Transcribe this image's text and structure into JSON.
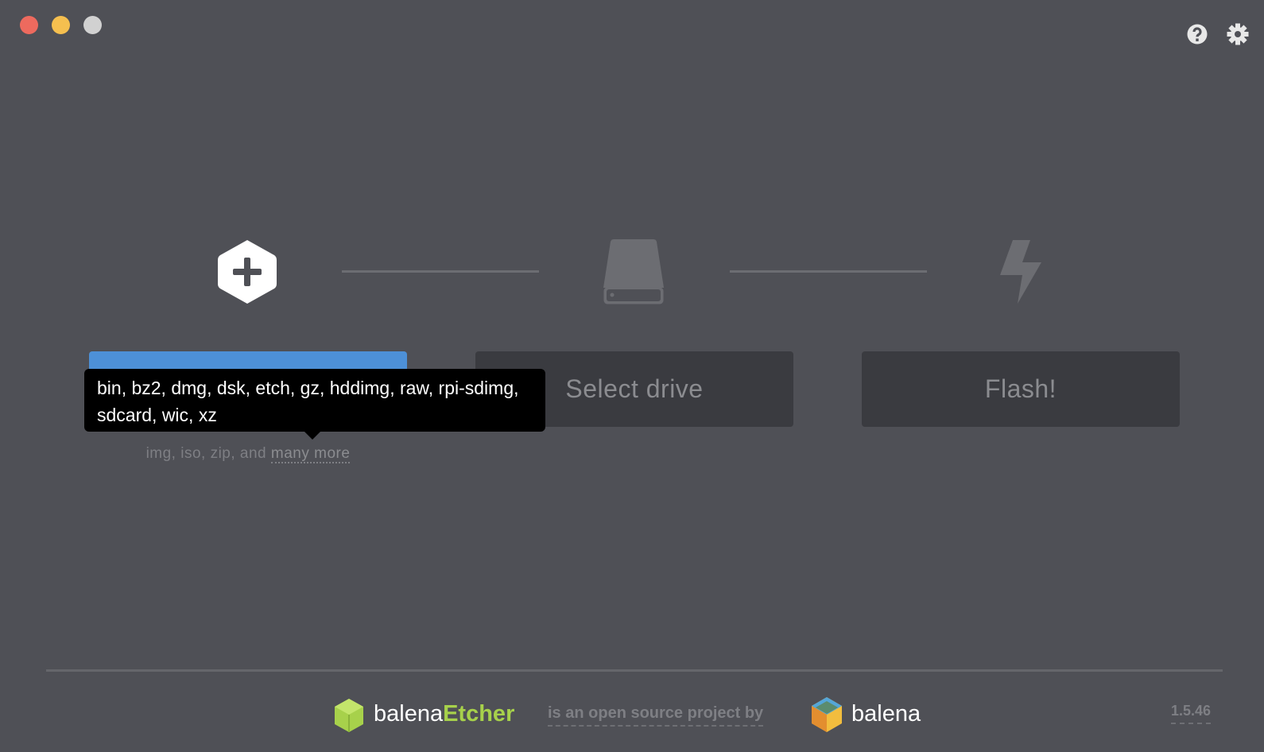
{
  "window": {
    "controls": [
      "close",
      "minimize",
      "maximize"
    ],
    "colors": {
      "close": "#ed6a5e",
      "minimize": "#f5bf4f",
      "maximize": "#d1d1d1"
    }
  },
  "header": {
    "help_icon": "question-circle-icon",
    "settings_icon": "gear-icon"
  },
  "steps": [
    {
      "icon": "hexagon-plus-icon",
      "button_label": "",
      "accent": "#4d90d7"
    },
    {
      "icon": "drive-icon",
      "button_label": "Select drive"
    },
    {
      "icon": "lightning-icon",
      "button_label": "Flash!"
    }
  ],
  "tooltip": {
    "text": "bin, bz2, dmg, dsk, etch, gz, hddimg, raw, rpi-sdimg, sdcard, wic, xz"
  },
  "supported": {
    "prefix": "img, iso, zip, and ",
    "link": "many more"
  },
  "footer": {
    "brand_part1": "balena",
    "brand_part2": "Etcher",
    "tagline": "is an open source project by",
    "company": "balena",
    "version": "1.5.46",
    "brand_color": "#a7d14b"
  }
}
